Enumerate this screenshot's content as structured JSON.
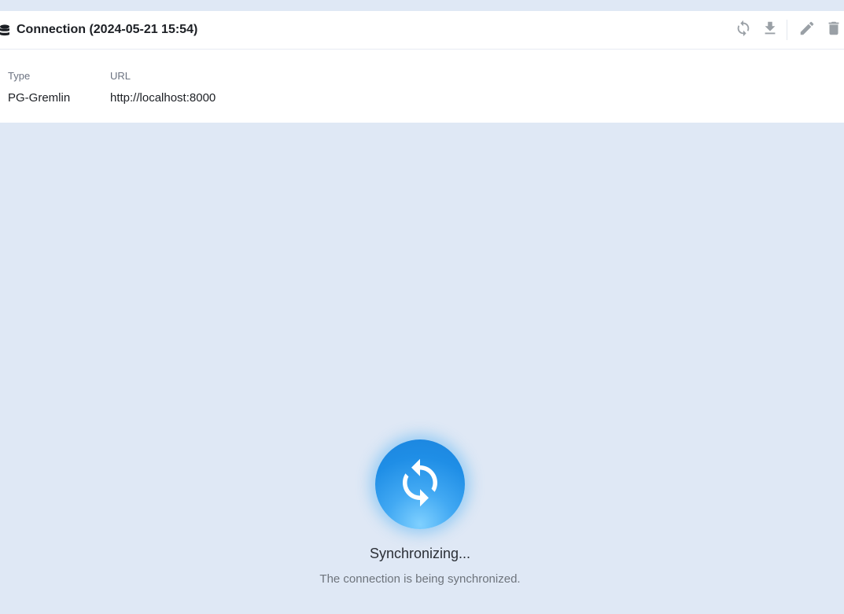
{
  "connection": {
    "title": "Connection (2024-05-21 15:54)",
    "fields": [
      {
        "label": "Type",
        "value": "PG-Gremlin"
      },
      {
        "label": "URL",
        "value": "http://localhost:8000"
      }
    ]
  },
  "actions": [
    {
      "name": "sync",
      "icon": "sync-icon"
    },
    {
      "name": "download",
      "icon": "download-icon"
    },
    {
      "name": "edit",
      "icon": "pencil-icon"
    },
    {
      "name": "delete",
      "icon": "trash-icon"
    }
  ],
  "status": {
    "title": "Synchronizing...",
    "message": "The connection is being synchronized."
  },
  "colors": {
    "background": "#dfe8f5",
    "accent": "#1f8ee6",
    "icon_gray": "#9aa0a6"
  }
}
